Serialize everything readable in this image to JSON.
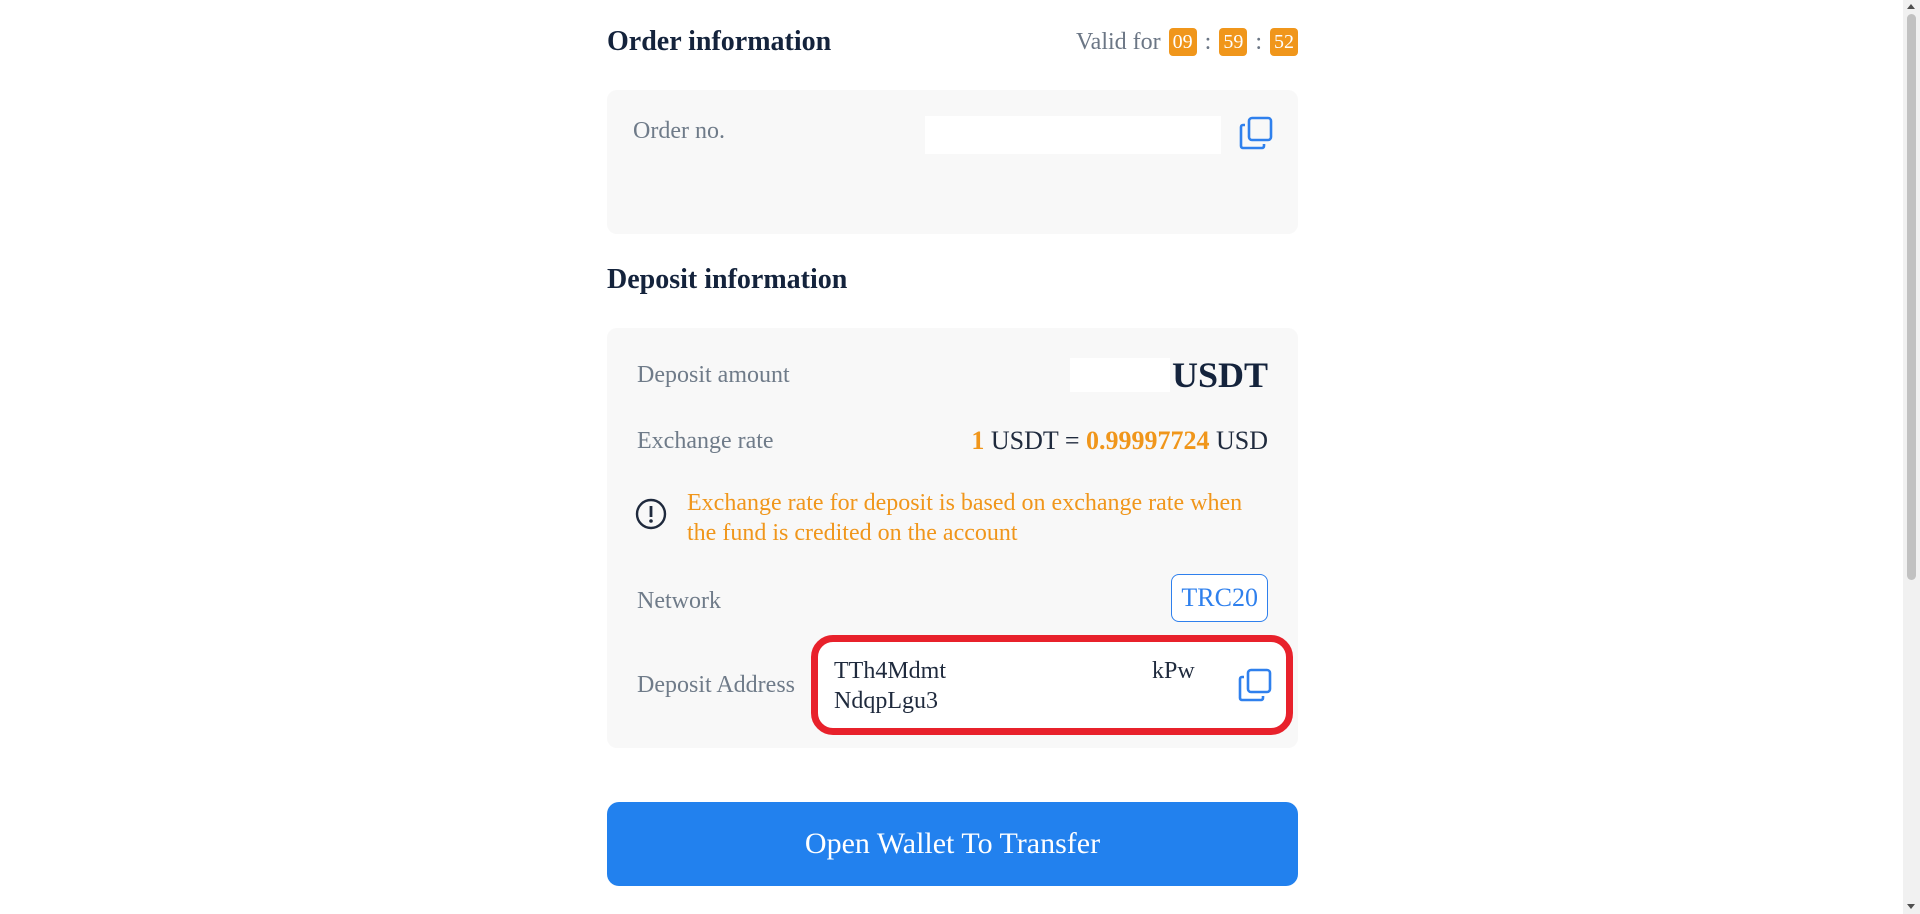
{
  "order": {
    "title": "Order information",
    "valid_label": "Valid for",
    "timer": {
      "hh": "09",
      "mm": "59",
      "ss": "52",
      "sep": ":"
    },
    "order_no_label": "Order no."
  },
  "deposit": {
    "title": "Deposit information",
    "amount_label": "Deposit amount",
    "amount_currency": "USDT",
    "rate_label": "Exchange rate",
    "rate": {
      "left_value": "1",
      "left_unit": "USDT",
      "equals": "=",
      "right_value": "0.99997724",
      "right_unit": "USD"
    },
    "notice": "Exchange rate for deposit is based on exchange rate when the fund is credited on the account",
    "network_label": "Network",
    "network_value": "TRC20",
    "address_label": "Deposit Address",
    "address_line1_start": "TTh4Mdmt",
    "address_line1_end": "kPw",
    "address_line2_start": "NdqpLgu3"
  },
  "action": {
    "button_label": "Open Wallet To Transfer"
  },
  "colors": {
    "accent": "#2281ee",
    "orange": "#f0961b",
    "highlight": "#e8212b"
  }
}
